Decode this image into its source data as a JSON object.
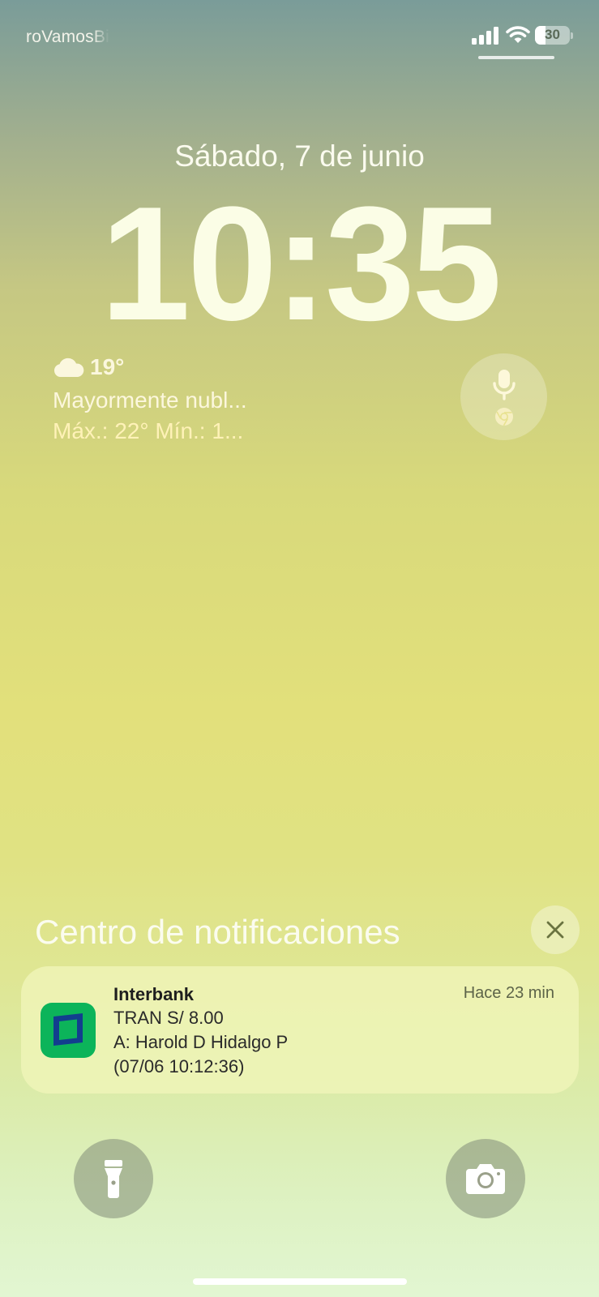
{
  "status_bar": {
    "carrier": "roVamosBi",
    "battery_percent": "30",
    "battery_level": 0.3,
    "signal_icon": "cellular-signal-icon",
    "wifi_icon": "wifi-icon"
  },
  "lock_screen": {
    "date": "Sábado, 7 de junio",
    "time": "10:35"
  },
  "weather": {
    "icon": "cloud-icon",
    "temperature": "19°",
    "condition": "Mayormente nubl...",
    "range": "Máx.: 22° Mín.: 1..."
  },
  "mic_widget": {
    "icon": "microphone-icon",
    "app_icon": "chrome-icon"
  },
  "notification_center": {
    "title": "Centro de notificaciones",
    "close_icon": "close-icon"
  },
  "notifications": [
    {
      "app": "Interbank",
      "time": "Hace 23 min",
      "lines": [
        "TRAN S/ 8.00",
        "A: Harold D Hidalgo P",
        "(07/06 10:12:36)"
      ],
      "icon": "interbank-app-icon"
    }
  ],
  "quick_actions": {
    "flashlight_icon": "flashlight-icon",
    "camera_icon": "camera-icon"
  },
  "colors": {
    "interbank_green": "#0cb45a",
    "interbank_blue": "#123e8e"
  }
}
